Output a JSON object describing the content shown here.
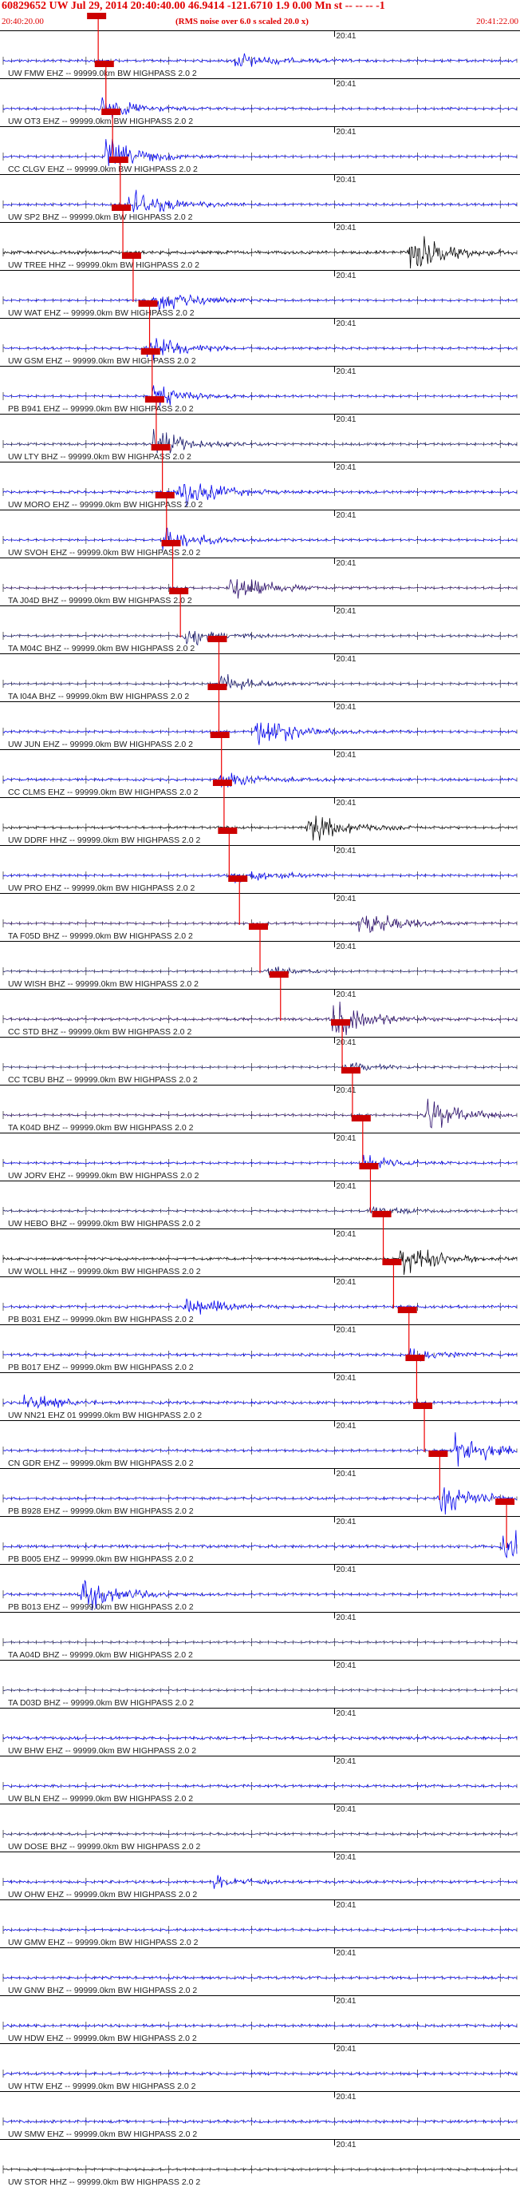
{
  "header": {
    "title": "60829652 UW Jul 29, 2014 20:40:40.00   46.9414 -121.6710  1.9 0.00 Mn st -- -- --  -1",
    "start_time": "20:40:20.00",
    "noise_note": "(RMS noise over 6.0 s scaled 20.0 x)",
    "end_time": "20:41:22.00"
  },
  "chart_data": {
    "type": "seismogram",
    "minute_label": "20:41",
    "window": [
      "20:40:20.00",
      "20:41:22.00"
    ],
    "colors": {
      "blue": "#0000ee",
      "black": "#000000",
      "navy": "#1a1a6e",
      "purple": "#2b0d6b",
      "pick": "#ee0000",
      "pick_box": "#cc0000"
    },
    "traces": [
      {
        "label": "UW FMW EHZ -- 99999.0km BW  HIGHPASS  2.0  2",
        "color": "blue",
        "pick": 0.185,
        "amp": 0.3,
        "burst": 0.45,
        "burst_pos": 0.46
      },
      {
        "label": "UW OT3 EHZ -- 99999.0km BW  HIGHPASS  2.0  2",
        "color": "blue",
        "pick": 0.2,
        "amp": 0.25,
        "burst": 0.6,
        "burst_pos": 0.2
      },
      {
        "label": "CC CLGV EHZ -- 99999.0km BW  HIGHPASS  2.0  2",
        "color": "blue",
        "pick": 0.213,
        "amp": 0.2,
        "burst": 0.9,
        "burst_pos": 0.21
      },
      {
        "label": "UW SP2 BHZ -- 99999.0km BW  HIGHPASS  2.0  2",
        "color": "blue",
        "pick": 0.228,
        "amp": 0.25,
        "burst": 1.0,
        "burst_pos": 0.25
      },
      {
        "label": "UW TREE HHZ -- 99999.0km BW  HIGHPASS  2.0  2",
        "color": "black",
        "pick": 0.233,
        "amp": 0.4,
        "burst": 1.0,
        "burst_pos": 0.8
      },
      {
        "label": "UW WAT EHZ -- 99999.0km BW  HIGHPASS  2.0  2",
        "color": "blue",
        "pick": 0.253,
        "amp": 0.2,
        "burst": 0.8,
        "burst_pos": 0.3
      },
      {
        "label": "UW GSM EHZ -- 99999.0km BW  HIGHPASS  2.0  2",
        "color": "blue",
        "pick": 0.285,
        "amp": 0.25,
        "burst": 0.7,
        "burst_pos": 0.29
      },
      {
        "label": "PB B941 EHZ -- 99999.0km BW  HIGHPASS  2.0  2",
        "color": "blue",
        "pick": 0.29,
        "amp": 0.2,
        "burst": 0.6,
        "burst_pos": 0.3
      },
      {
        "label": "UW LTY BHZ -- 99999.0km BW  HIGHPASS  2.0  2",
        "color": "navy",
        "pick": 0.298,
        "amp": 0.25,
        "burst": 0.8,
        "burst_pos": 0.3
      },
      {
        "label": "UW MORO EHZ -- 99999.0km BW  HIGHPASS  2.0  2",
        "color": "blue",
        "pick": 0.31,
        "amp": 0.3,
        "burst": 1.0,
        "burst_pos": 0.35
      },
      {
        "label": "UW SVOH EHZ -- 99999.0km BW  HIGHPASS  2.0  2",
        "color": "blue",
        "pick": 0.318,
        "amp": 0.2,
        "burst": 0.7,
        "burst_pos": 0.32
      },
      {
        "label": "TA J04D BHZ -- 99999.0km BW  HIGHPASS  2.0  2",
        "color": "purple",
        "pick": 0.33,
        "amp": 0.2,
        "burst": 0.9,
        "burst_pos": 0.45
      },
      {
        "label": "TA M04C BHZ -- 99999.0km BW  HIGHPASS  2.0  2",
        "color": "navy",
        "pick": 0.345,
        "amp": 0.25,
        "burst": 0.6,
        "burst_pos": 0.36
      },
      {
        "label": "TA I04A BHZ -- 99999.0km BW  HIGHPASS  2.0  2",
        "color": "navy",
        "pick": 0.42,
        "amp": 0.2,
        "burst": 0.5,
        "burst_pos": 0.43
      },
      {
        "label": "UW JUN EHZ -- 99999.0km BW  HIGHPASS  2.0  2",
        "color": "blue",
        "pick": 0.42,
        "amp": 0.25,
        "burst": 1.0,
        "burst_pos": 0.5
      },
      {
        "label": "CC CLMS EHZ -- 99999.0km BW  HIGHPASS  2.0  2",
        "color": "blue",
        "pick": 0.425,
        "amp": 0.3,
        "burst": 0.5,
        "burst_pos": 0.43
      },
      {
        "label": "UW DDRF HHZ -- 99999.0km BW  HIGHPASS  2.0  2",
        "color": "black",
        "pick": 0.43,
        "amp": 0.25,
        "burst": 1.0,
        "burst_pos": 0.6
      },
      {
        "label": "UW PRO EHZ -- 99999.0km BW  HIGHPASS  2.0  2",
        "color": "blue",
        "pick": 0.44,
        "amp": 0.25,
        "burst": 0.5,
        "burst_pos": 0.46
      },
      {
        "label": "TA F05D BHZ -- 99999.0km BW  HIGHPASS  2.0  2",
        "color": "purple",
        "pick": 0.46,
        "amp": 0.2,
        "burst": 1.0,
        "burst_pos": 0.7
      },
      {
        "label": "UW WISH BHZ -- 99999.0km BW  HIGHPASS  2.0  2",
        "color": "navy",
        "pick": 0.5,
        "amp": 0.15,
        "burst": 0.3,
        "burst_pos": 0.52
      },
      {
        "label": "CC STD BHZ -- 99999.0km BW  HIGHPASS  2.0  2",
        "color": "purple",
        "pick": 0.54,
        "amp": 0.3,
        "burst": 1.0,
        "burst_pos": 0.65
      },
      {
        "label": "CC TCBU BHZ -- 99999.0km BW  HIGHPASS  2.0  2",
        "color": "navy",
        "pick": 0.66,
        "amp": 0.15,
        "burst": 0.3,
        "burst_pos": 0.67
      },
      {
        "label": "TA K04D BHZ -- 99999.0km BW  HIGHPASS  2.0  2",
        "color": "purple",
        "pick": 0.68,
        "amp": 0.2,
        "burst": 0.9,
        "burst_pos": 0.83
      },
      {
        "label": "UW JORV EHZ -- 99999.0km BW  HIGHPASS  2.0  2",
        "color": "blue",
        "pick": 0.7,
        "amp": 0.2,
        "burst": 0.4,
        "burst_pos": 0.71
      },
      {
        "label": "UW HEBO BHZ -- 99999.0km BW  HIGHPASS  2.0  2",
        "color": "navy",
        "pick": 0.715,
        "amp": 0.2,
        "burst": 0.3,
        "burst_pos": 0.72
      },
      {
        "label": "UW WOLL HHZ -- 99999.0km BW  HIGHPASS  2.0  2",
        "color": "black",
        "pick": 0.74,
        "amp": 0.3,
        "burst": 1.0,
        "burst_pos": 0.78
      },
      {
        "label": "PB B031 EHZ -- 99999.0km BW  HIGHPASS  2.0  2",
        "color": "blue",
        "pick": 0.76,
        "amp": 0.3,
        "burst": 0.6,
        "burst_pos": 0.36
      },
      {
        "label": "PB B017 EHZ -- 99999.0km BW  HIGHPASS  2.0  2",
        "color": "blue",
        "pick": 0.79,
        "amp": 0.3,
        "burst": 0.4,
        "burst_pos": 0.8
      },
      {
        "label": "UW NN21 EHZ 01 99999.0km BW  HIGHPASS  2.0  2",
        "color": "blue",
        "pick": 0.805,
        "amp": 0.3,
        "burst": 0.5,
        "burst_pos": 0.05
      },
      {
        "label": "CN GDR EHZ -- 99999.0km BW  HIGHPASS  2.0  2",
        "color": "blue",
        "pick": 0.82,
        "amp": 0.25,
        "burst": 1.0,
        "burst_pos": 0.89
      },
      {
        "label": "PB B928 EHZ -- 99999.0km BW  HIGHPASS  2.0  2",
        "color": "blue",
        "pick": 0.85,
        "amp": 0.3,
        "burst": 0.9,
        "burst_pos": 0.86
      },
      {
        "label": "PB B005 EHZ -- 99999.0km BW  HIGHPASS  2.0  2",
        "color": "blue",
        "pick": 0.98,
        "amp": 0.35,
        "burst": 1.0,
        "burst_pos": 0.98
      },
      {
        "label": "PB B013 EHZ -- 99999.0km BW  HIGHPASS  2.0  2",
        "color": "blue",
        "pick": null,
        "amp": 0.25,
        "burst": 1.0,
        "burst_pos": 0.16
      },
      {
        "label": "TA A04D BHZ -- 99999.0km BW  HIGHPASS  2.0  2",
        "color": "navy",
        "pick": null,
        "amp": 0.15,
        "burst": 0,
        "burst_pos": 0.5
      },
      {
        "label": "TA D03D BHZ -- 99999.0km BW  HIGHPASS  2.0  2",
        "color": "navy",
        "pick": null,
        "amp": 0.15,
        "burst": 0,
        "burst_pos": 0.5
      },
      {
        "label": "UW BHW EHZ -- 99999.0km BW  HIGHPASS  2.0  2",
        "color": "blue",
        "pick": null,
        "amp": 0.35,
        "burst": 0,
        "burst_pos": 0.5
      },
      {
        "label": "UW BLN EHZ -- 99999.0km BW  HIGHPASS  2.0  2",
        "color": "blue",
        "pick": null,
        "amp": 0.3,
        "burst": 0,
        "burst_pos": 0.5
      },
      {
        "label": "UW DOSE BHZ -- 99999.0km BW  HIGHPASS  2.0  2",
        "color": "navy",
        "pick": null,
        "amp": 0.25,
        "burst": 0,
        "burst_pos": 0.5
      },
      {
        "label": "UW OHW EHZ -- 99999.0km BW  HIGHPASS  2.0  2",
        "color": "blue",
        "pick": null,
        "amp": 0.3,
        "burst": 0.3,
        "burst_pos": 0.42
      },
      {
        "label": "UW GMW EHZ -- 99999.0km BW  HIGHPASS  2.0  2",
        "color": "blue",
        "pick": null,
        "amp": 0.25,
        "burst": 0,
        "burst_pos": 0.5
      },
      {
        "label": "UW GNW BHZ -- 99999.0km BW  HIGHPASS  2.0  2",
        "color": "blue",
        "pick": null,
        "amp": 0.3,
        "burst": 0,
        "burst_pos": 0.5
      },
      {
        "label": "UW HDW EHZ -- 99999.0km BW  HIGHPASS  2.0  2",
        "color": "blue",
        "pick": null,
        "amp": 0.3,
        "burst": 0,
        "burst_pos": 0.5
      },
      {
        "label": "UW HTW EHZ -- 99999.0km BW  HIGHPASS  2.0  2",
        "color": "blue",
        "pick": null,
        "amp": 0.3,
        "burst": 0,
        "burst_pos": 0.5
      },
      {
        "label": "UW SMW EHZ -- 99999.0km BW  HIGHPASS  2.0  2",
        "color": "blue",
        "pick": null,
        "amp": 0.3,
        "burst": 0,
        "burst_pos": 0.5
      },
      {
        "label": "UW STOR HHZ -- 99999.0km BW  HIGHPASS  2.0  2",
        "color": "black",
        "pick": null,
        "amp": 0.2,
        "burst": 0,
        "burst_pos": 0.5
      }
    ]
  }
}
